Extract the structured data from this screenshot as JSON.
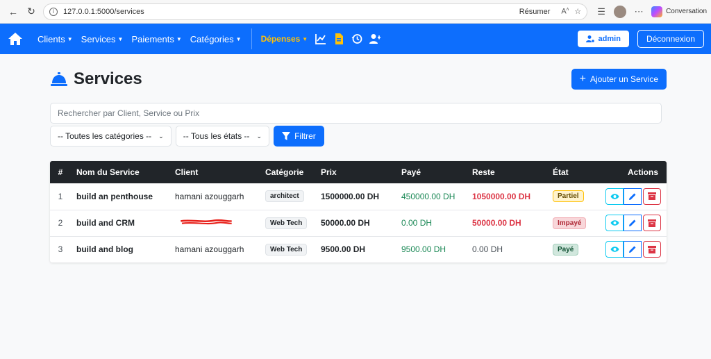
{
  "browser": {
    "url": "127.0.0.1:5000/services",
    "resumer": "Résumer",
    "conversation": "Conversation"
  },
  "navbar": {
    "items": [
      {
        "label": "Clients"
      },
      {
        "label": "Services"
      },
      {
        "label": "Paiements"
      },
      {
        "label": "Catégories"
      }
    ],
    "depenses": "Dépenses",
    "admin_label": "admin",
    "logout_label": "Déconnexion"
  },
  "page": {
    "title": "Services",
    "add_button": "Ajouter un Service",
    "search_placeholder": "Rechercher par Client, Service ou Prix",
    "category_filter": "-- Toutes les catégories --",
    "state_filter": "-- Tous les états --",
    "filter_button": "Filtrer"
  },
  "table": {
    "headers": [
      "#",
      "Nom du Service",
      "Client",
      "Catégorie",
      "Prix",
      "Payé",
      "Reste",
      "État",
      "Actions"
    ],
    "rows": [
      {
        "num": "1",
        "name": "build an penthouse",
        "client": "hamani azouggarh",
        "category": "architect",
        "price": "1500000.00 DH",
        "paid": "450000.00 DH",
        "rest": "1050000.00 DH",
        "state": "Partiel"
      },
      {
        "num": "2",
        "name": "build and CRM",
        "client": "",
        "category": "Web Tech",
        "price": "50000.00 DH",
        "paid": "0.00 DH",
        "rest": "50000.00 DH",
        "state": "Impayé"
      },
      {
        "num": "3",
        "name": "build and blog",
        "client": "hamani azouggarh",
        "category": "Web Tech",
        "price": "9500.00 DH",
        "paid": "9500.00 DH",
        "rest": "0.00 DH",
        "state": "Payé"
      }
    ]
  },
  "colors": {
    "primary": "#0d6efd",
    "warning": "#ffc107",
    "danger": "#dc3545",
    "success": "#198754",
    "dark": "#212529"
  }
}
